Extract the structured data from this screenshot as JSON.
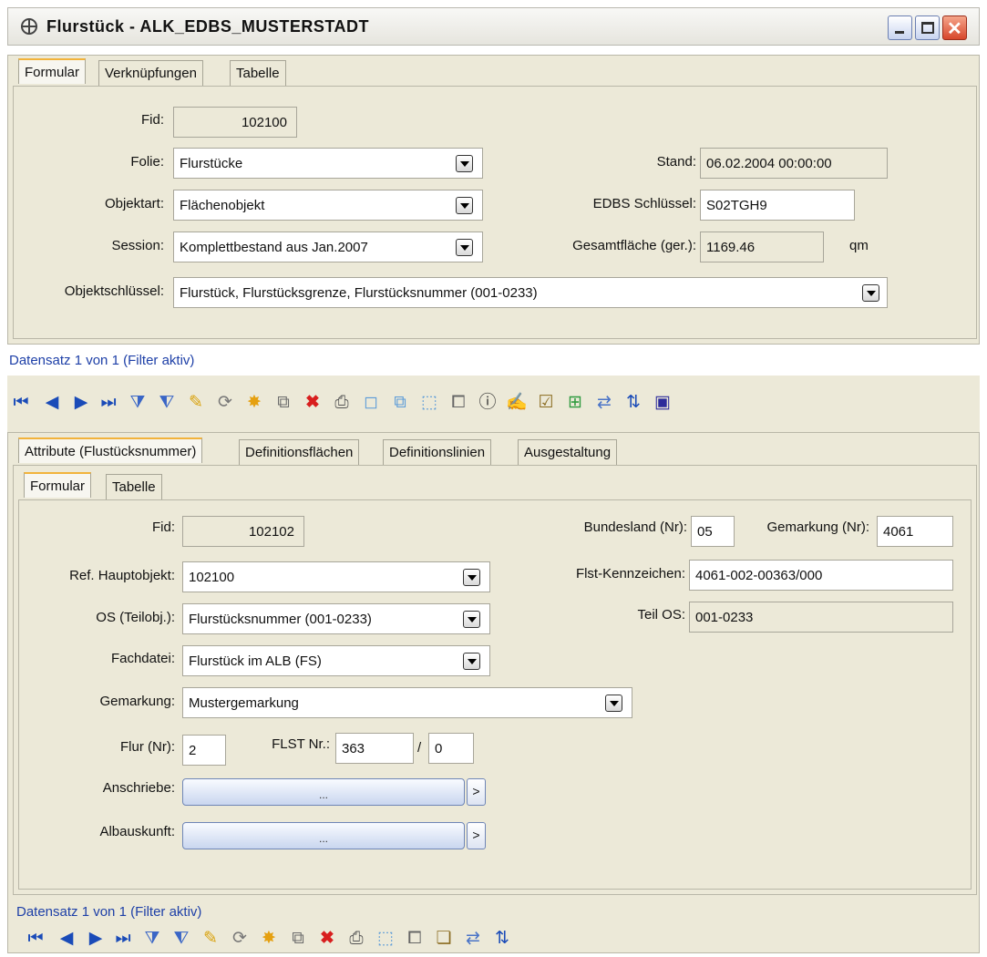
{
  "window": {
    "title": "Flurstück - ALK_EDBS_MUSTERSTADT",
    "colors": {
      "title_bg": "#e9e8e1",
      "panel_bg": "#ece9d8",
      "status_text": "#1d3fa7",
      "active_tab_accent": "#f2b33b",
      "close_button": "#d7472b"
    }
  },
  "top_tabs": [
    "Formular",
    "Verknüpfungen",
    "Tabelle"
  ],
  "top_form": {
    "fid_label": "Fid:",
    "fid_value": "102100",
    "folie_label": "Folie:",
    "folie_value": "Flurstücke",
    "objektart_label": "Objektart:",
    "objektart_value": "Flächenobjekt",
    "session_label": "Session:",
    "session_value": "Komplettbestand aus Jan.2007",
    "objektschluessel_label": "Objektschlüssel:",
    "objektschluessel_value": "Flurstück, Flurstücksgrenze, Flurstücksnummer  (001-0233)",
    "stand_label": "Stand:",
    "stand_value": "06.02.2004 00:00:00",
    "edbs_label": "EDBS Schlüssel:",
    "edbs_value": "S02TGH9",
    "gesamtflaeche_label": "Gesamtfläche (ger.):",
    "gesamtflaeche_value": "1169.46",
    "unit": "qm"
  },
  "top_status": "Datensatz 1 von 1 (Filter aktiv)",
  "top_toolbar": [
    "first-record-icon",
    "prev-record-icon",
    "next-record-icon",
    "last-record-icon",
    "filter-icon",
    "filter-off-icon",
    "edit-pencil-icon",
    "refresh-icon",
    "new-record-icon",
    "copy-record-icon",
    "delete-icon",
    "print-icon",
    "select-icon",
    "multi-select-icon",
    "select-frame-icon",
    "clone-icon",
    "info-icon",
    "form-edit-icon",
    "form-check-icon",
    "add-geometry-icon",
    "link-icon",
    "sort-icon",
    "map-icon"
  ],
  "bottom_tabs": [
    "Attribute (Flustücksnummer)",
    "Definitionsflächen",
    "Definitionslinien",
    "Ausgestaltung"
  ],
  "inner_tabs": [
    "Formular",
    "Tabelle"
  ],
  "bottom_form": {
    "fid_label": "Fid:",
    "fid_value": "102102",
    "ref_label": "Ref. Hauptobjekt:",
    "ref_value": "102100",
    "os_label": "OS (Teilobj.):",
    "os_value": "Flurstücksnummer  (001-0233)",
    "fachdatei_label": "Fachdatei:",
    "fachdatei_value": "Flurstück im ALB  (FS)",
    "gemarkung_label": "Gemarkung:",
    "gemarkung_value": "Mustergemarkung",
    "flur_label": "Flur (Nr):",
    "flur_value": "2",
    "flst_label": "FLST Nr.:",
    "flst_value": "363",
    "slash": "/",
    "flst_sub_value": "0",
    "anschriebe_label": "Anschriebe:",
    "albauskunft_label": "Albauskunft:",
    "ellipsis": "...",
    "arrow": ">",
    "bundesland_label": "Bundesland (Nr):",
    "bundesland_value": "05",
    "gemarkung_nr_label": "Gemarkung (Nr):",
    "gemarkung_nr_value": "4061",
    "kennzeichen_label": "Flst-Kennzeichen:",
    "kennzeichen_value": "4061-002-00363/000",
    "teil_os_label": "Teil OS:",
    "teil_os_value": "001-0233"
  },
  "bottom_status": "Datensatz 1 von 1 (Filter aktiv)",
  "bottom_toolbar": [
    "first-record-icon",
    "prev-record-icon",
    "next-record-icon",
    "last-record-icon",
    "filter-icon",
    "filter-off-icon",
    "edit-pencil-icon",
    "refresh-icon",
    "new-record-icon",
    "copy-record-icon",
    "delete-icon",
    "print-icon",
    "select-frame-icon",
    "clone-icon",
    "new-form-icon",
    "link-icon",
    "sort-icon"
  ]
}
